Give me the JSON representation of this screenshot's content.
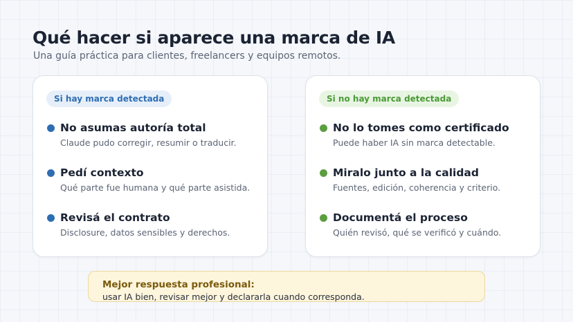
{
  "header": {
    "title": "Qué hacer si aparece una marca de IA",
    "subtitle": "Una guía práctica para clientes, freelancers y equipos remotos."
  },
  "cards": [
    {
      "badge": "Si hay marca detectada",
      "accent": "#2f6db3",
      "items": [
        {
          "title": "No asumas autoría total",
          "desc": "Claude pudo corregir, resumir o traducir."
        },
        {
          "title": "Pedí contexto",
          "desc": "Qué parte fue humana y qué parte asistida."
        },
        {
          "title": "Revisá el contrato",
          "desc": "Disclosure, datos sensibles y derechos."
        }
      ]
    },
    {
      "badge": "Si no hay marca detectada",
      "accent": "#5b9e3f",
      "items": [
        {
          "title": "No lo tomes como certificado",
          "desc": "Puede haber IA sin marca detectable."
        },
        {
          "title": "Miralo junto a la calidad",
          "desc": "Fuentes, edición, coherencia y criterio."
        },
        {
          "title": "Documentá el proceso",
          "desc": "Quién revisó, qué se verificó y cuándo."
        }
      ]
    }
  ],
  "callout": {
    "title": "Mejor respuesta profesional:",
    "text": "usar IA bien, revisar mejor y declararla cuando corresponda."
  }
}
